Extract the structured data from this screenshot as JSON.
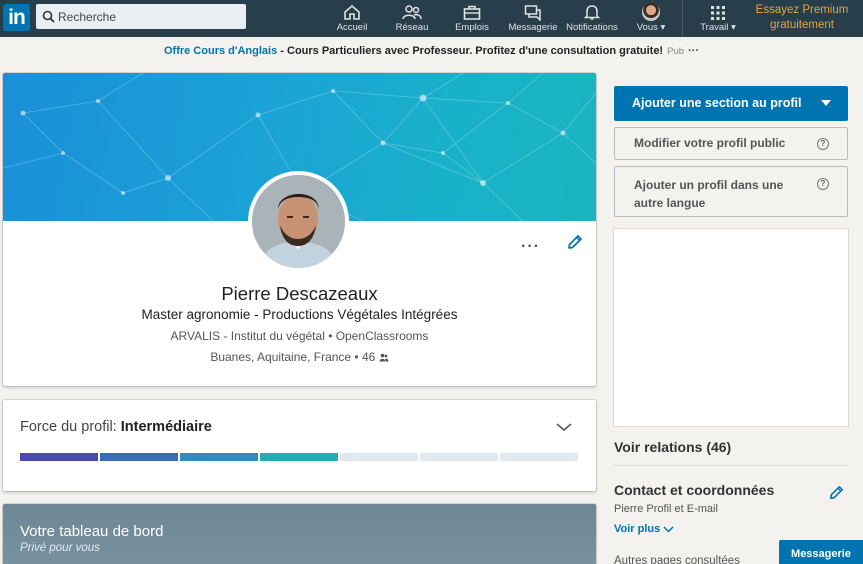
{
  "nav": {
    "logo": "in",
    "search_placeholder": "Recherche",
    "items": [
      {
        "label": "Accueil",
        "icon": "home-icon"
      },
      {
        "label": "Réseau",
        "icon": "network-icon"
      },
      {
        "label": "Emplois",
        "icon": "jobs-icon"
      },
      {
        "label": "Messagerie",
        "icon": "messaging-icon"
      },
      {
        "label": "Notifications",
        "icon": "bell-icon"
      },
      {
        "label": "Vous ▾",
        "icon": "avatar"
      },
      {
        "label": "Travail ▾",
        "icon": "grid-icon"
      }
    ],
    "premium": "Essayez Premium gratuitement"
  },
  "ad": {
    "link": "Offre Cours d'Anglais",
    "text": " - Cours Particuliers avec Professeur. Profitez d'une consultation gratuite!",
    "pub": "Pub",
    "more": "···"
  },
  "profile": {
    "name": "Pierre Descazeaux",
    "headline": "Master agronomie - Productions Végétales Intégrées",
    "company": "ARVALIS - Institut du végétal • OpenClassrooms",
    "location": "Buanes, Aquitaine, France • 46",
    "more": "···"
  },
  "strength": {
    "label": "Force du profil: ",
    "level": "Intermédiaire",
    "filled_segments": 4,
    "total_segments": 7,
    "colors": [
      "#4a4ab0",
      "#3c6cb5",
      "#2f8fb9",
      "#22aeb3",
      "#e1e9ee",
      "#e1e9ee",
      "#e1e9ee"
    ]
  },
  "dashboard": {
    "title": "Votre tableau de bord",
    "subtitle": "Privé pour vous"
  },
  "sidebar": {
    "add_section": "Ajouter une section au profil",
    "edit_public": "Modifier votre profil public",
    "add_language": "Ajouter un profil dans une autre langue",
    "help_icon": "?",
    "relations": "Voir relations (46)",
    "contact_title": "Contact et coordonnées",
    "contact_sub": "Pierre Profil et E-mail",
    "voir_plus": "Voir plus",
    "other_pages": "Autres pages consultées"
  },
  "messaging": "Messagerie",
  "colors": {
    "nav_bg": "#283e4a",
    "brand_blue": "#0073b1",
    "premium_gold": "#e7a33e"
  }
}
